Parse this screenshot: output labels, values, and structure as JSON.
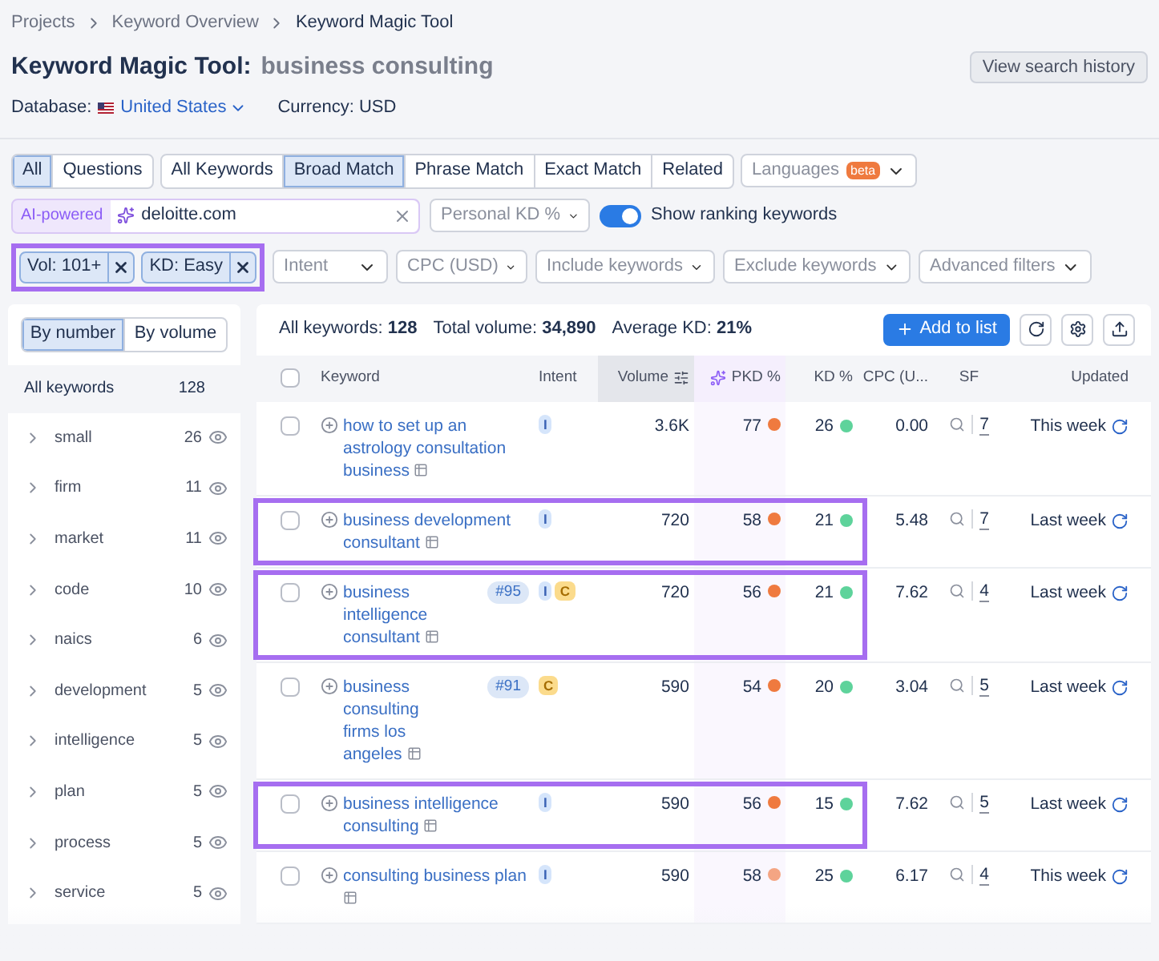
{
  "breadcrumbs": [
    "Projects",
    "Keyword Overview",
    "Keyword Magic Tool"
  ],
  "title": "Keyword Magic Tool:",
  "query": "business consulting",
  "history_button": "View search history",
  "database_label": "Database:",
  "database": "United States",
  "currency": "Currency: USD",
  "question_tabs": [
    {
      "label": "All",
      "selected": true
    },
    {
      "label": "Questions",
      "selected": false
    }
  ],
  "match_tabs": [
    {
      "label": "All Keywords",
      "selected": false
    },
    {
      "label": "Broad Match",
      "selected": true
    },
    {
      "label": "Phrase Match",
      "selected": false
    },
    {
      "label": "Exact Match",
      "selected": false
    },
    {
      "label": "Related",
      "selected": false
    }
  ],
  "languages": {
    "label": "Languages",
    "badge": "beta"
  },
  "ai_label": "AI-powered",
  "domain_field": {
    "value": "deloitte.com"
  },
  "personal_kd": "Personal KD %",
  "ranking_toggle": {
    "label": "Show ranking keywords",
    "on": true
  },
  "active_filters": {
    "highlighted": true,
    "chips": [
      "Vol: 101+",
      "KD: Easy"
    ]
  },
  "filter_dropdowns": [
    "Intent",
    "CPC (USD)",
    "Include keywords",
    "Exclude keywords",
    "Advanced filters"
  ],
  "group_tabs": [
    {
      "label": "By number",
      "selected": true
    },
    {
      "label": "By volume",
      "selected": false
    }
  ],
  "groups_header": {
    "label": "All keywords",
    "count": "128"
  },
  "groups": [
    {
      "label": "small",
      "count": "26"
    },
    {
      "label": "firm",
      "count": "11"
    },
    {
      "label": "market",
      "count": "11"
    },
    {
      "label": "code",
      "count": "10"
    },
    {
      "label": "naics",
      "count": "6"
    },
    {
      "label": "development",
      "count": "5"
    },
    {
      "label": "intelligence",
      "count": "5"
    },
    {
      "label": "plan",
      "count": "5"
    },
    {
      "label": "process",
      "count": "5"
    },
    {
      "label": "service",
      "count": "5"
    }
  ],
  "summary": [
    {
      "label": "All keywords:",
      "value": "128"
    },
    {
      "label": "Total volume:",
      "value": "34,890"
    },
    {
      "label": "Average KD:",
      "value": "21%"
    }
  ],
  "add_button": "Add to list",
  "table": {
    "select_all": {
      "checked": false
    },
    "columns": [
      "Keyword",
      "Intent",
      "Volume",
      "PKD %",
      "KD %",
      "CPC (U...",
      "SF",
      "Updated"
    ],
    "rows": [
      {
        "keyword": "how to set up an astrology consultation business",
        "rank": null,
        "intents": [
          {
            "kind": "informational",
            "label": "I"
          }
        ],
        "volume": "3.6K",
        "pkd": {
          "value": "77",
          "color": "#ef7a3f"
        },
        "kd": {
          "value": "26",
          "color": "#5ed39b"
        },
        "cpc": "0.00",
        "sf": "7",
        "updated": "This week",
        "highlighted": false
      },
      {
        "keyword": "business development consultant",
        "rank": null,
        "intents": [
          {
            "kind": "informational",
            "label": "I"
          }
        ],
        "volume": "720",
        "pkd": {
          "value": "58",
          "color": "#ef7a3f"
        },
        "kd": {
          "value": "21",
          "color": "#5ed39b"
        },
        "cpc": "5.48",
        "sf": "7",
        "updated": "Last week",
        "highlighted": true
      },
      {
        "keyword": "business intelligence consultant",
        "rank": "#95",
        "intents": [
          {
            "kind": "informational",
            "label": "I"
          },
          {
            "kind": "commercial",
            "label": "C"
          }
        ],
        "volume": "720",
        "pkd": {
          "value": "56",
          "color": "#ef7a3f"
        },
        "kd": {
          "value": "21",
          "color": "#5ed39b"
        },
        "cpc": "7.62",
        "sf": "4",
        "updated": "Last week",
        "highlighted": true
      },
      {
        "keyword": "business consulting firms los angeles",
        "rank": "#91",
        "intents": [
          {
            "kind": "commercial",
            "label": "C"
          }
        ],
        "volume": "590",
        "pkd": {
          "value": "54",
          "color": "#ef7a3f"
        },
        "kd": {
          "value": "20",
          "color": "#5ed39b"
        },
        "cpc": "3.04",
        "sf": "5",
        "updated": "Last week",
        "highlighted": false
      },
      {
        "keyword": "business intelligence consulting",
        "rank": null,
        "intents": [
          {
            "kind": "informational",
            "label": "I"
          }
        ],
        "volume": "590",
        "pkd": {
          "value": "56",
          "color": "#ef7a3f"
        },
        "kd": {
          "value": "15",
          "color": "#5ed39b"
        },
        "cpc": "7.62",
        "sf": "5",
        "updated": "Last week",
        "highlighted": true
      },
      {
        "keyword": "consulting business plan",
        "rank": null,
        "intents": [
          {
            "kind": "informational",
            "label": "I"
          }
        ],
        "volume": "590",
        "pkd": {
          "value": "58",
          "color": "#f4a583"
        },
        "kd": {
          "value": "25",
          "color": "#5ed39b"
        },
        "cpc": "6.17",
        "sf": "4",
        "updated": "This week",
        "highlighted": false
      }
    ]
  }
}
